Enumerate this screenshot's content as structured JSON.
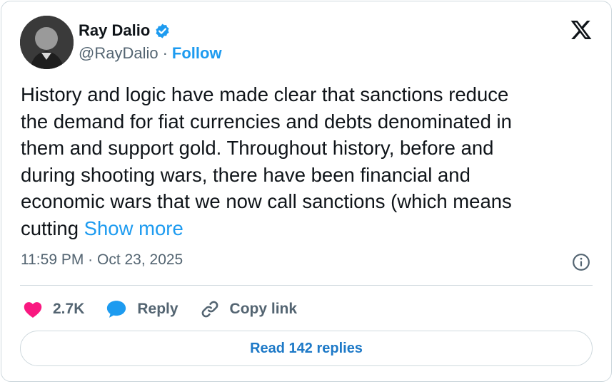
{
  "author": {
    "name": "Ray Dalio",
    "handle": "@RayDalio",
    "separator": "·",
    "follow_label": "Follow",
    "verified": true
  },
  "tweet": {
    "text": "History and logic have made clear that sanctions reduce\nthe demand for fiat currencies and debts denominated in\nthem and support gold. Throughout history, before and\nduring shooting wars, there have been financial and\neconomic wars that we now call sanctions (which means\ncutting ",
    "show_more_label": "Show more",
    "timestamp": "11:59 PM · Oct 23, 2025"
  },
  "actions": {
    "like_count": "2.7K",
    "reply_label": "Reply",
    "copy_link_label": "Copy link"
  },
  "read_replies_label": "Read 142 replies",
  "icons": {
    "brand": "x-logo-icon",
    "verified": "verified-badge-icon",
    "info": "info-icon",
    "like": "heart-icon",
    "reply": "speech-bubble-icon",
    "copy": "link-icon"
  },
  "colors": {
    "accent": "#1d9bf0",
    "text": "#0f1419",
    "muted": "#536471",
    "like": "#f91880",
    "border": "#cfd9de"
  }
}
